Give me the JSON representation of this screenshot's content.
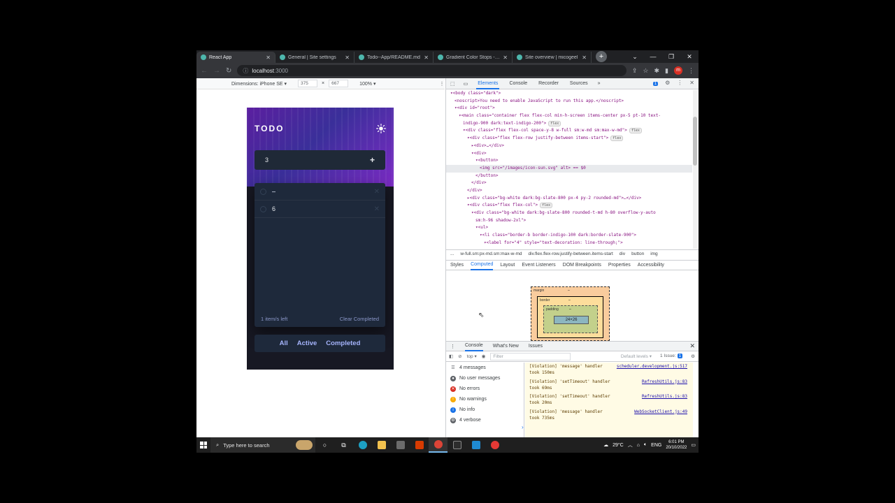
{
  "browser": {
    "tabs": [
      {
        "title": "React App",
        "active": true
      },
      {
        "title": "General | Site settings",
        "active": false
      },
      {
        "title": "Todo--App/README.md",
        "active": false
      },
      {
        "title": "Gradient Color Stops - Ta",
        "active": false
      },
      {
        "title": "Site overview | micogeel",
        "active": false
      }
    ],
    "url_host": "localhost",
    "url_port": ":3000",
    "profile_initial": "m"
  },
  "device_toolbar": {
    "dimensions_label": "Dimensions: iPhone SE",
    "width": "375",
    "height": "667",
    "zoom": "100%"
  },
  "todo_app": {
    "title": "TODO",
    "input_value": "3",
    "add_symbol": "+",
    "items": [
      {
        "text": "–",
        "completed": true
      },
      {
        "text": "6",
        "completed": false
      }
    ],
    "items_left": "1 item/s left",
    "clear_completed": "Clear Completed",
    "filters": [
      "All",
      "Active",
      "Completed"
    ]
  },
  "devtools": {
    "tabs": [
      "Elements",
      "Console",
      "Recorder",
      "Sources"
    ],
    "active_tab": "Elements",
    "issues_badge": "1",
    "elements_lines": [
      {
        "indent": 1,
        "text": "▾<body class=\"dark\">"
      },
      {
        "indent": 2,
        "text": "<noscript>You need to enable JavaScript to run this app.</noscript>"
      },
      {
        "indent": 2,
        "text": "▾<div id=\"root\">"
      },
      {
        "indent": 3,
        "text": "▾<main class=\"container flex flex-col min-h-screen items-center px-5 pt-10 text-"
      },
      {
        "indent": 4,
        "text": "indigo-900 dark:text-indigo-200\">",
        "badge": "flex"
      },
      {
        "indent": 4,
        "text": "▾<div class=\"flex flex-col space-y-8 w-full sm:w-md sm:max-w-md\">",
        "badge": "flex"
      },
      {
        "indent": 5,
        "text": "▾<div class=\"flex flex-row justify-between items-start\">",
        "badge": "flex"
      },
      {
        "indent": 6,
        "text": "▸<div>…</div>"
      },
      {
        "indent": 6,
        "text": "▾<div>"
      },
      {
        "indent": 7,
        "text": "▾<button>"
      },
      {
        "indent": 8,
        "text": "<img src=\"/images/icon-sun.svg\" alt> == $0",
        "selected": true
      },
      {
        "indent": 7,
        "text": "</button>"
      },
      {
        "indent": 6,
        "text": "</div>"
      },
      {
        "indent": 5,
        "text": "</div>"
      },
      {
        "indent": 5,
        "text": "▸<div class=\"bg-white dark:bg-slate-800 px-4 py-2 rounded-md\">…</div>"
      },
      {
        "indent": 5,
        "text": "▾<div class=\"flex flex-col\">",
        "badge": "flex"
      },
      {
        "indent": 6,
        "text": "▾<div class=\"bg-white dark:bg-slate-800  rounded-t-md h-80 overflow-y-auto"
      },
      {
        "indent": 7,
        "text": "sm:h-96 shadow-2xl\">"
      },
      {
        "indent": 7,
        "text": "▾<ul>"
      },
      {
        "indent": 8,
        "text": "▾<li class=\"border-b border-indigo-100 dark:border-slate-900\">"
      },
      {
        "indent": 9,
        "text": "▾<label for=\"4\" style=\"text-decoration: line-through;\">"
      }
    ],
    "breadcrumbs": [
      "...",
      "w-full.sm:px-md.sm:max-w-md",
      "div.flex.flex-row.justify-between.items-start",
      "div",
      "button",
      "img"
    ],
    "sub_tabs": [
      "Styles",
      "Computed",
      "Layout",
      "Event Listeners",
      "DOM Breakpoints",
      "Properties",
      "Accessibility"
    ],
    "active_sub_tab": "Computed",
    "box_model": {
      "margin_label": "margin",
      "border_label": "border",
      "padding_label": "padding",
      "dash": "–",
      "content_size": "24×26"
    },
    "drawer_tabs": [
      "Console",
      "What's New",
      "Issues"
    ],
    "console_context": "top",
    "filter_placeholder": "Filter",
    "default_levels": "Default levels",
    "issues_count": "1 Issue:",
    "issues_num": "1",
    "sidebar": [
      {
        "label": "4 messages",
        "icon": "list"
      },
      {
        "label": "No user messages",
        "icon": "user"
      },
      {
        "label": "No errors",
        "icon": "error"
      },
      {
        "label": "No warnings",
        "icon": "warning"
      },
      {
        "label": "No info",
        "icon": "info"
      },
      {
        "label": "4 verbose",
        "icon": "verbose"
      }
    ],
    "messages": [
      {
        "text": "[Violation] 'message' handler took 150ms",
        "source": "scheduler.development.js:517"
      },
      {
        "text": "[Violation] 'setTimeout' handler took 69ms",
        "source": "RefreshUtils.js:83"
      },
      {
        "text": "[Violation] 'setTimeout' handler took 20ms",
        "source": "RefreshUtils.js:83"
      },
      {
        "text": "[Violation] 'message' handler took 735ms",
        "source": "WebSocketClient.js:49"
      }
    ]
  },
  "taskbar": {
    "search_placeholder": "Type here to search",
    "weather": "29°C",
    "language": "ENG",
    "time": "6:01 PM",
    "date": "20/10/2022"
  },
  "colors": {
    "accent": "#1a73e8",
    "todo_bg": "#171823",
    "todo_card": "#1e293b",
    "filter_text": "#a5b4fc"
  }
}
